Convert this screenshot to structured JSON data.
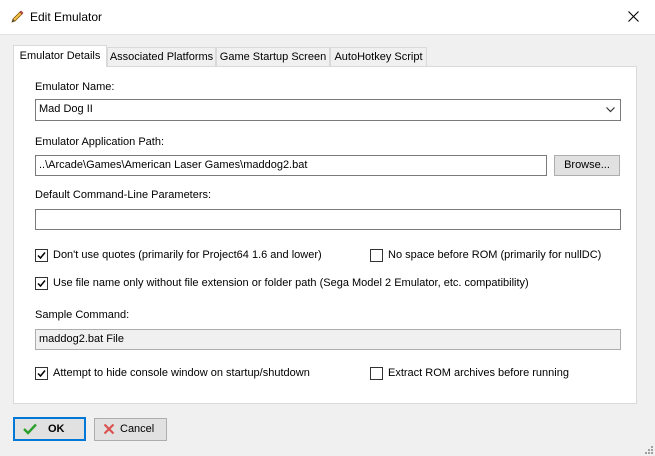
{
  "window": {
    "title": "Edit Emulator"
  },
  "tabs": [
    {
      "label": "Emulator Details",
      "active": true
    },
    {
      "label": "Associated Platforms",
      "active": false
    },
    {
      "label": "Game Startup Screen",
      "active": false
    },
    {
      "label": "AutoHotkey Script",
      "active": false
    }
  ],
  "form": {
    "name_label": "Emulator Name:",
    "name_value": "Mad Dog II",
    "path_label": "Emulator Application Path:",
    "path_value": "..\\Arcade\\Games\\American Laser Games\\maddog2.bat",
    "browse_label": "Browse...",
    "params_label": "Default Command-Line Parameters:",
    "params_value": "",
    "options": {
      "no_quotes": {
        "label": "Don't use quotes (primarily for Project64 1.6 and lower)",
        "checked": true
      },
      "no_space": {
        "label": "No space before ROM (primarily for nullDC)",
        "checked": false
      },
      "filename_only": {
        "label": "Use file name only without file extension or folder path (Sega Model 2 Emulator, etc. compatibility)",
        "checked": true
      },
      "hide_console": {
        "label": "Attempt to hide console window on startup/shutdown",
        "checked": true
      },
      "extract_rom": {
        "label": "Extract ROM archives before running",
        "checked": false
      }
    },
    "sample_label": "Sample Command:",
    "sample_value": "maddog2.bat File"
  },
  "buttons": {
    "ok_label": "OK",
    "cancel_label": "Cancel"
  },
  "colors": {
    "accent": "#0078d7",
    "ok_icon": "#2ca02c",
    "cancel_icon": "#d9534f"
  }
}
